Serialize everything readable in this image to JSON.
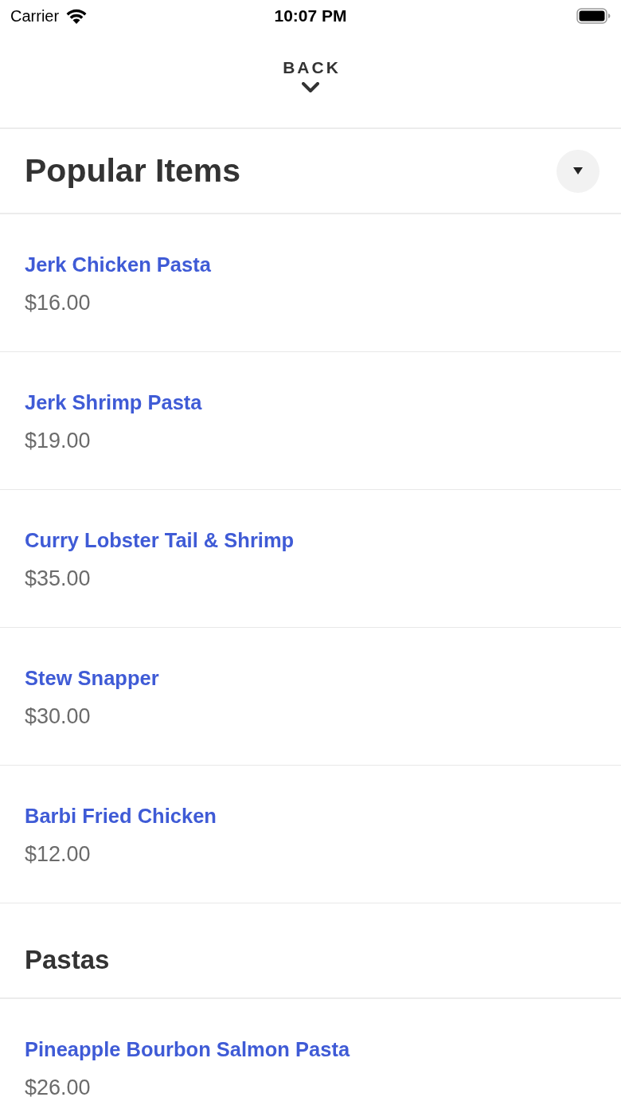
{
  "status_bar": {
    "carrier": "Carrier",
    "time": "10:07 PM"
  },
  "header": {
    "back_label": "BACK"
  },
  "sections": [
    {
      "kind": "picker",
      "title": "Popular Items",
      "items": [
        {
          "name": "Jerk Chicken Pasta",
          "price": "$16.00"
        },
        {
          "name": "Jerk Shrimp Pasta",
          "price": "$19.00"
        },
        {
          "name": "Curry Lobster Tail & Shrimp",
          "price": "$35.00"
        },
        {
          "name": "Stew Snapper",
          "price": "$30.00"
        },
        {
          "name": "Barbi Fried Chicken",
          "price": "$12.00"
        }
      ]
    },
    {
      "kind": "heading",
      "title": "Pastas",
      "items": [
        {
          "name": "Pineapple Bourbon Salmon Pasta",
          "price": "$26.00"
        }
      ]
    }
  ]
}
